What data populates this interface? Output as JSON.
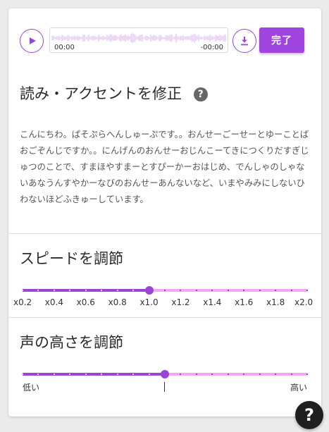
{
  "player": {
    "time_start": "00:00",
    "time_end": "-00:00",
    "done_label": "完了"
  },
  "reading_section": {
    "title": "読み・アクセントを修正",
    "help_icon": "?",
    "text": "こんにちわ。ぱそぷらへんしゅーぷです。。おんせーごーせーとゆーことばおごぞんじですか。。にんげんのおんせーおじんこーてきにつくりだすぎじゅつのことで、すまほやすまーとすぴーかーおはじめ、でんしゃのしゃないあなうんすやかーなびのおんせーあんないなど、いまやみみにしないひわないほどふきゅーしています。"
  },
  "speed_section": {
    "title": "スピードを調節",
    "value": 1.0,
    "min": 0.2,
    "max": 2.0,
    "labels": [
      "x0.2",
      "x0.4",
      "x0.6",
      "x0.8",
      "x1.0",
      "x1.2",
      "x1.4",
      "x1.6",
      "x1.8",
      "x2.0"
    ]
  },
  "pitch_section": {
    "title": "声の高さを調節",
    "value": 0.5,
    "low_label": "低い",
    "high_label": "高い"
  },
  "help_fab": "?",
  "colors": {
    "accent": "#9b44d8",
    "track_rest": "#f4a6f1",
    "button": "#a044e0"
  }
}
